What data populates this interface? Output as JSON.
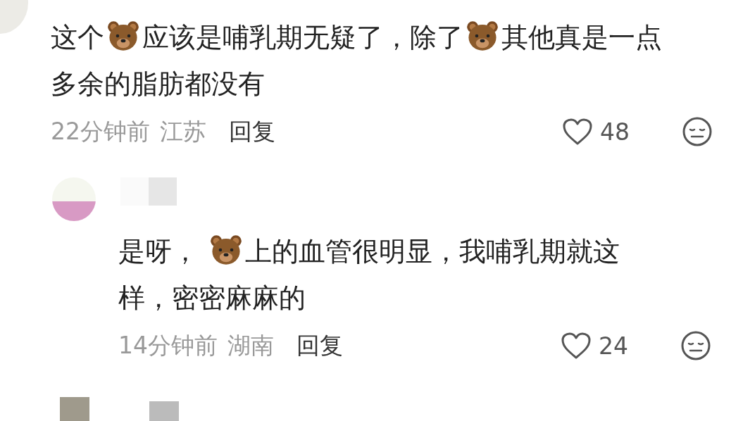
{
  "comments": [
    {
      "text": [
        {
          "kind": "text",
          "text": "这个"
        },
        {
          "kind": "emoji"
        },
        {
          "kind": "text",
          "text": "应该是哺乳期无疑了，除了"
        },
        {
          "kind": "emoji"
        },
        {
          "kind": "text",
          "text": "其他真是一点多余的脂肪都没有"
        }
      ],
      "time": "22分钟前",
      "location": "江苏",
      "reply": "回复",
      "likes": "48",
      "indent": false
    },
    {
      "text": [
        {
          "kind": "text",
          "text": "是呀， "
        },
        {
          "kind": "emoji"
        },
        {
          "kind": "text",
          "text": "上的血管很明显，我哺乳期就这样，密密麻麻的"
        }
      ],
      "time": "14分钟前",
      "location": "湖南",
      "reply": "回复",
      "likes": "24",
      "indent": true
    }
  ]
}
